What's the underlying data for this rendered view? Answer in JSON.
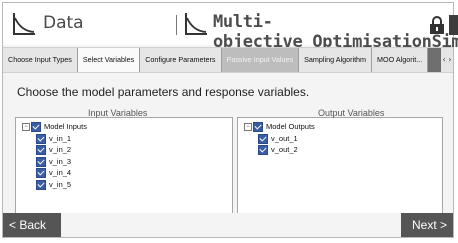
{
  "header": {
    "left_title": "Data",
    "right_title": "Multi-objective_OptimisationSim"
  },
  "tabs": [
    {
      "label": "Choose Input Types",
      "state": "normal"
    },
    {
      "label": "Select Variables",
      "state": "active"
    },
    {
      "label": "Configure Parameters",
      "state": "normal"
    },
    {
      "label": "Passive Input Values",
      "state": "disabled"
    },
    {
      "label": "Sampling Algorithm",
      "state": "normal"
    },
    {
      "label": "MOO Algorit...",
      "state": "normal"
    }
  ],
  "tab_scroll": "‹ ›",
  "main": {
    "instruction": "Choose the model parameters and response variables.",
    "input_panel": {
      "legend": "Input Variables",
      "root": "Model Inputs",
      "items": [
        "v_in_1",
        "v_in_2",
        "v_in_3",
        "v_in_4",
        "v_in_5"
      ]
    },
    "output_panel": {
      "legend": "Output Variables",
      "root": "Model Outputs",
      "items": [
        "v_out_1",
        "v_out_2"
      ]
    }
  },
  "footer": {
    "back_label": "< Back",
    "next_label": "Next >"
  },
  "colors": {
    "checkbox": "#3a5ea5",
    "tab_bar": "#6f6f6f",
    "button_bg": "#555555"
  }
}
